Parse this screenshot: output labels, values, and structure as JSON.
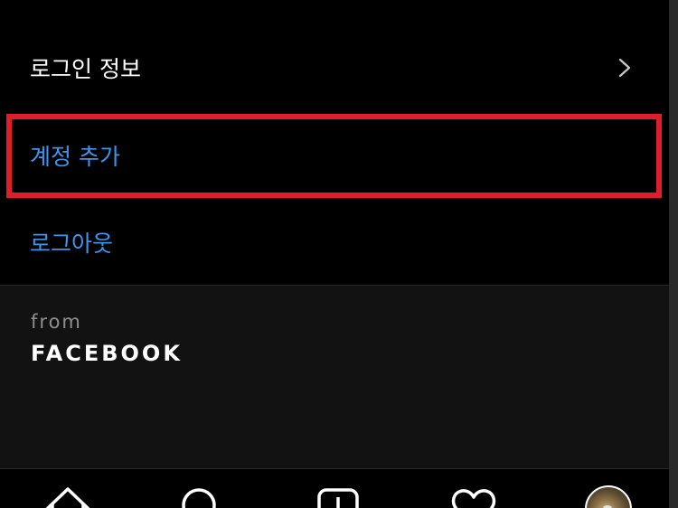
{
  "settings": {
    "login_info_label": "로그인 정보",
    "add_account_label": "계정 추가",
    "logout_label": "로그아웃"
  },
  "footer": {
    "from_label": "from",
    "brand_label": "FACEBOOK"
  },
  "tabs": [
    {
      "name": "home",
      "icon": "home-icon"
    },
    {
      "name": "search",
      "icon": "search-icon"
    },
    {
      "name": "new-post",
      "icon": "plus-square-icon"
    },
    {
      "name": "activity",
      "icon": "heart-icon"
    },
    {
      "name": "profile",
      "icon": "avatar"
    }
  ],
  "colors": {
    "background": "#000000",
    "footer_background": "#121212",
    "link_blue": "#3b96f0",
    "highlight_red": "#e01e2b",
    "muted_text": "#8e8e8e"
  }
}
